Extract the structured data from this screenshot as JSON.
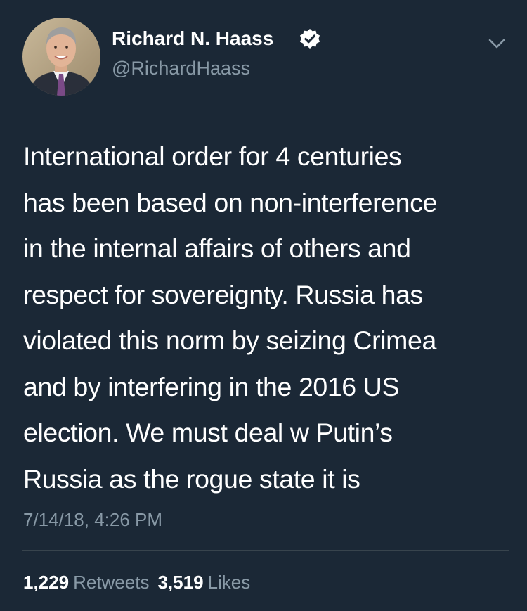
{
  "user": {
    "display_name": "Richard N. Haass",
    "handle": "@RichardHaass",
    "verified_icon": "verified-badge-icon",
    "menu_icon": "chevron-down-icon"
  },
  "tweet": {
    "lines": [
      "International order for 4 centuries",
      "has been based on non-interference",
      "in the internal affairs of others and",
      "respect for sovereignty. Russia has",
      "violated this norm by seizing Crimea",
      "and by interfering in the 2016 US",
      "election. We must deal w Putin’s",
      "Russia as the rogue state it is"
    ],
    "timestamp": "7/14/18, 4:26 PM"
  },
  "stats": {
    "retweets_count": "1,229",
    "retweets_label": "Retweets",
    "likes_count": "3,519",
    "likes_label": "Likes"
  },
  "colors": {
    "background": "#1b2836",
    "primary_text": "#ffffff",
    "secondary_text": "#8899a6",
    "divider": "#38444d"
  }
}
